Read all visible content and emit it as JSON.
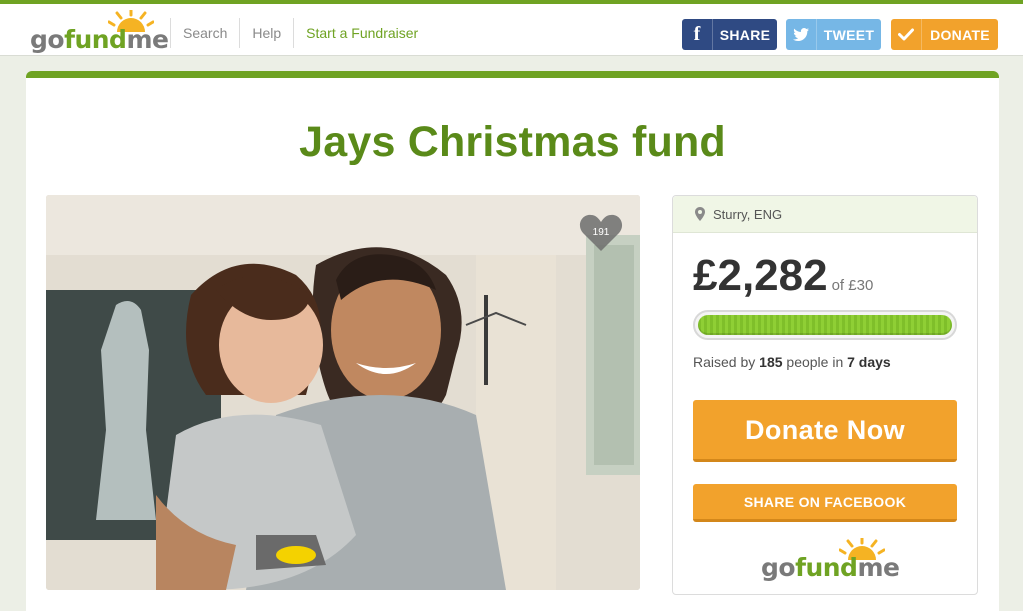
{
  "header": {
    "logo": {
      "go": "go",
      "fund": "fund",
      "me": "me"
    },
    "nav": [
      "Search",
      "Help",
      "Start a Fundraiser"
    ],
    "share_label": "SHARE",
    "tweet_label": "TWEET",
    "donate_label": "DONATE",
    "icons": {
      "share": "facebook-icon",
      "tweet": "twitter-icon",
      "donate": "checkmark-icon"
    }
  },
  "campaign": {
    "title": "Jays Christmas fund",
    "hearts": "191",
    "location": "Sturry, ENG",
    "raised": "£2,282",
    "goal": "of £30",
    "progress_percent": 100,
    "stats": {
      "prefix": "Raised by ",
      "people": "185",
      "mid": " people in ",
      "days": "7 days"
    },
    "donate_now": "Donate Now",
    "share_facebook": "SHARE ON FACEBOOK"
  },
  "colors": {
    "brand_green": "#6fa323",
    "orange": "#f2a22c",
    "facebook": "#2f4a83",
    "twitter": "#76b7e6"
  }
}
